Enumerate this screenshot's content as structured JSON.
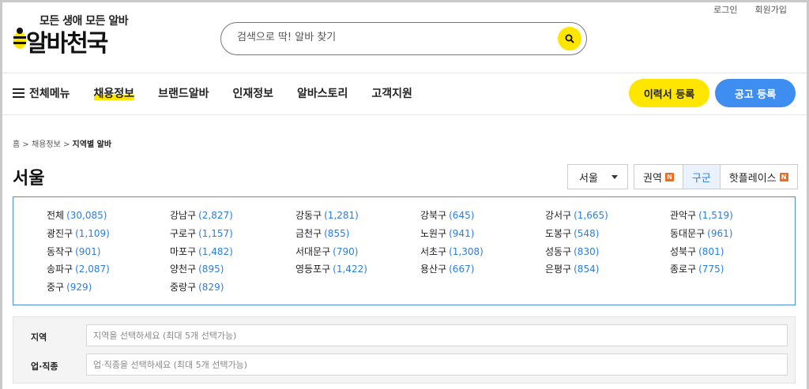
{
  "top_links": {
    "login": "로그인",
    "signup": "회원가입"
  },
  "logo": {
    "slogan": "모든 생애 모든 알바",
    "name": "알바천국"
  },
  "search": {
    "placeholder": "검색으로 딱! 알바 찾기"
  },
  "nav": {
    "menu_label": "전체메뉴",
    "items": [
      "채용정보",
      "브랜드알바",
      "인재정보",
      "알바스토리",
      "고객지원"
    ],
    "active": "채용정보"
  },
  "buttons": {
    "resume": "이력서 등록",
    "post": "공고 등록"
  },
  "breadcrumb": {
    "home": "홈",
    "section": "채용정보",
    "current": "지역별 알바",
    "sep": ">"
  },
  "page_title": "서울",
  "city_select": {
    "value": "서울"
  },
  "view_tabs": [
    {
      "label": "권역",
      "badge": "N"
    },
    {
      "label": "구군",
      "badge": ""
    },
    {
      "label": "핫플레이스",
      "badge": "N"
    }
  ],
  "districts": [
    {
      "name": "전체",
      "count": "(30,085)"
    },
    {
      "name": "강남구",
      "count": "(2,827)"
    },
    {
      "name": "강동구",
      "count": "(1,281)"
    },
    {
      "name": "강북구",
      "count": "(645)"
    },
    {
      "name": "강서구",
      "count": "(1,665)"
    },
    {
      "name": "관악구",
      "count": "(1,519)"
    },
    {
      "name": "광진구",
      "count": "(1,109)"
    },
    {
      "name": "구로구",
      "count": "(1,157)"
    },
    {
      "name": "금천구",
      "count": "(855)"
    },
    {
      "name": "노원구",
      "count": "(941)"
    },
    {
      "name": "도봉구",
      "count": "(548)"
    },
    {
      "name": "동대문구",
      "count": "(961)"
    },
    {
      "name": "동작구",
      "count": "(901)"
    },
    {
      "name": "마포구",
      "count": "(1,482)"
    },
    {
      "name": "서대문구",
      "count": "(790)"
    },
    {
      "name": "서초구",
      "count": "(1,308)"
    },
    {
      "name": "성동구",
      "count": "(830)"
    },
    {
      "name": "성북구",
      "count": "(801)"
    },
    {
      "name": "송파구",
      "count": "(2,087)"
    },
    {
      "name": "양천구",
      "count": "(895)"
    },
    {
      "name": "영등포구",
      "count": "(1,422)"
    },
    {
      "name": "용산구",
      "count": "(667)"
    },
    {
      "name": "은평구",
      "count": "(854)"
    },
    {
      "name": "종로구",
      "count": "(775)"
    },
    {
      "name": "중구",
      "count": "(929)"
    },
    {
      "name": "중랑구",
      "count": "(829)"
    }
  ],
  "filters": {
    "region": {
      "label": "지역",
      "placeholder": "지역을 선택하세요 (최대 5개 선택가능)"
    },
    "job": {
      "label": "업·직종",
      "placeholder": "업·직종을 선택하세요 (최대 5개 선택가능)"
    }
  },
  "colors": {
    "accent_yellow": "#ffe600",
    "accent_blue": "#3d8ef0",
    "count_blue": "#2a7de1",
    "badge_orange": "#f26b1d"
  }
}
